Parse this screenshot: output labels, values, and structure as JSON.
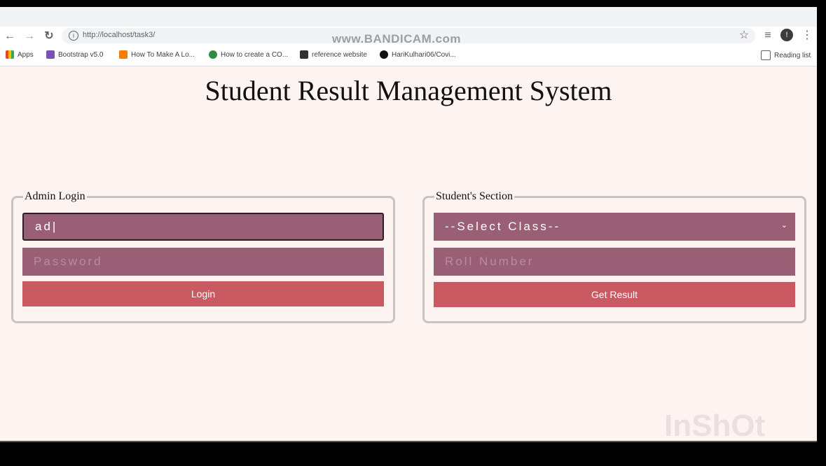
{
  "browser": {
    "url": "http://localhost/task3/",
    "watermark": "www.BANDICAM.com",
    "bookmarks": [
      {
        "label": "Apps"
      },
      {
        "label": "Bootstrap v5.0"
      },
      {
        "label": "How To Make A Lo..."
      },
      {
        "label": "How to create a CO..."
      },
      {
        "label": "reference website"
      },
      {
        "label": "HariKulhari06/Covi..."
      }
    ],
    "reading_list": "Reading list"
  },
  "page": {
    "title": "Student Result Management System",
    "admin": {
      "legend": "Admin Login",
      "username_value": "ad|",
      "password_placeholder": "Password",
      "login_label": "Login"
    },
    "student": {
      "legend": "Student's Section",
      "class_select_value": "--Select Class--",
      "roll_placeholder": "Roll Number",
      "get_result_label": "Get Result"
    }
  },
  "overlay": {
    "inshot_watermark": "InShOt"
  },
  "colors": {
    "field_bg": "#9a5f75",
    "button_bg": "#c95a61",
    "page_bg": "#fdf3f1"
  }
}
